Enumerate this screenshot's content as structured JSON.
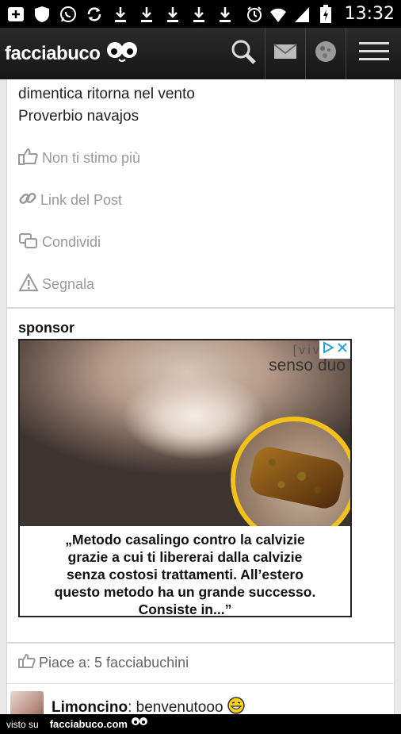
{
  "statusbar": {
    "time": "13:32",
    "icons": [
      "add-box-icon",
      "shield-icon",
      "whatsapp-icon",
      "sync-icon",
      "download-icon",
      "download-icon",
      "download-icon",
      "download-icon",
      "download-icon",
      "alarm-icon",
      "wifi-icon",
      "signal-icon",
      "battery-charging-icon"
    ]
  },
  "appbar": {
    "logo": "facciabuco",
    "actions": [
      "search-icon",
      "mail-icon",
      "profile-icon",
      "menu-icon"
    ]
  },
  "post": {
    "quote_line1": "dimentica ritorna nel vento",
    "quote_line2": "Proverbio navajos",
    "actions": [
      {
        "icon": "thumbs-up-icon",
        "label": "Non ti stimo più"
      },
      {
        "icon": "link-icon",
        "label": "Link del Post"
      },
      {
        "icon": "share-icon",
        "label": "Condividi"
      },
      {
        "icon": "warning-icon",
        "label": "Segnala"
      }
    ]
  },
  "sponsor": {
    "title": "sponsor",
    "ad": {
      "brand_line1": "[vivès]",
      "brand_line2": "senso duo",
      "text_line1": "„Metodo casalingo contro la calvizie",
      "text_line2": "grazie a cui ti libererai dalla calvizie",
      "text_line3": "senza costosi trattamenti. All’estero",
      "text_line4": "questo metodo ha un grande successo.",
      "text_line5": "Consiste in...”"
    }
  },
  "likes": {
    "text": "Piace a: 5 facciabuchini"
  },
  "comment": {
    "author": "Limoncino",
    "separator": ": ",
    "text": "benvenutooo"
  },
  "footer": {
    "visto": "visto su",
    "site": "facciabuco.com"
  },
  "colors": {
    "appbar": "#1e1e1e",
    "accent_yellow": "#f2c21a",
    "action_gray": "#999999"
  }
}
